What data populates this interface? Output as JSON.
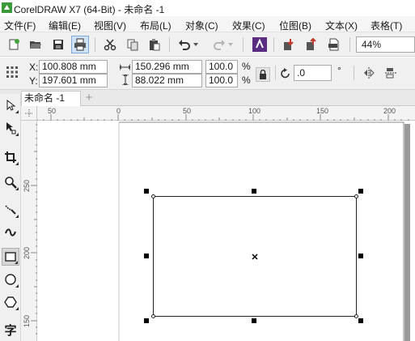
{
  "window": {
    "title": "CorelDRAW X7 (64-Bit) - 未命名 -1"
  },
  "menu": [
    "文件(F)",
    "编辑(E)",
    "视图(V)",
    "布局(L)",
    "对象(C)",
    "效果(C)",
    "位图(B)",
    "文本(X)",
    "表格(T)"
  ],
  "toolbar": {
    "zoom": "44%"
  },
  "properties": {
    "x_label": "X:",
    "x_value": "100.808 mm",
    "y_label": "Y:",
    "y_value": "197.601 mm",
    "width_value": "150.296 mm",
    "height_value": "88.022 mm",
    "scale_w": "100.0",
    "scale_h": "100.0",
    "percent": "%",
    "rotation": ".0",
    "degree": "°"
  },
  "tabs": {
    "document": "未命名 -1",
    "add": "+"
  },
  "rulers": {
    "horizontal": [
      "50",
      "0",
      "50",
      "100",
      "150",
      "200"
    ],
    "vertical": [
      "250",
      "200",
      "150"
    ]
  },
  "toolbox": {
    "text_tool": "字"
  }
}
